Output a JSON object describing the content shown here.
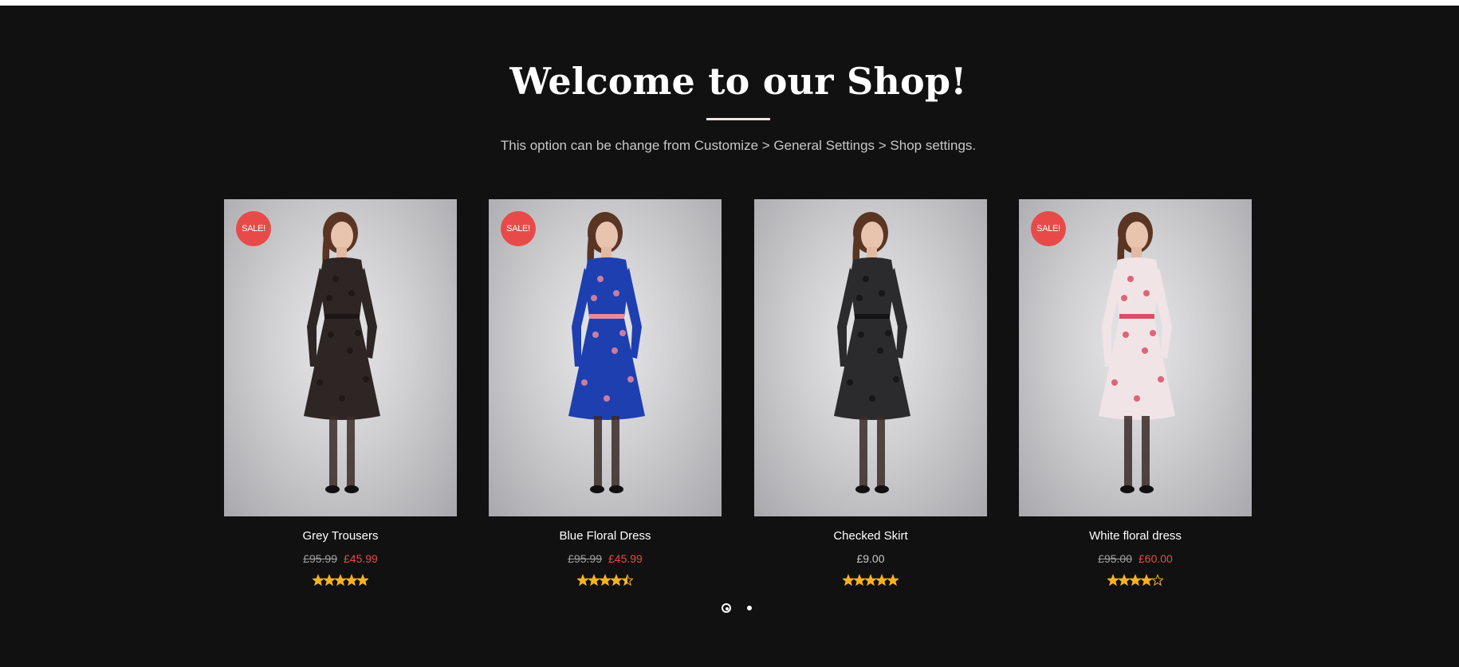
{
  "shop": {
    "title": "Welcome to our Shop!",
    "subtitle": "This option can be change from Customize > General Settings > Shop settings."
  },
  "products": [
    {
      "name": "Grey Trousers",
      "sale_badge": "SALE!",
      "price_old": "£95.99",
      "price_new": "£45.99",
      "rating": 5,
      "dress_color": "#2e2624",
      "accent_color": "#1b1716"
    },
    {
      "name": "Blue Floral Dress",
      "sale_badge": "SALE!",
      "price_old": "£95.99",
      "price_new": "£45.99",
      "rating": 4.5,
      "dress_color": "#1e3fb0",
      "accent_color": "#e58aa0"
    },
    {
      "name": "Checked Skirt",
      "sale_badge": "",
      "price": "£9.00",
      "rating": 5,
      "dress_color": "#2b2b2e",
      "accent_color": "#141416"
    },
    {
      "name": "White floral dress",
      "sale_badge": "SALE!",
      "price_old": "£95.00",
      "price_new": "£60.00",
      "rating": 4,
      "dress_color": "#f1e4e6",
      "accent_color": "#d75066"
    }
  ],
  "carousel": {
    "pages": 2,
    "active_page": 1
  },
  "colors": {
    "background": "#111111",
    "sale": "#e84a4a",
    "star": "#f5b324"
  }
}
